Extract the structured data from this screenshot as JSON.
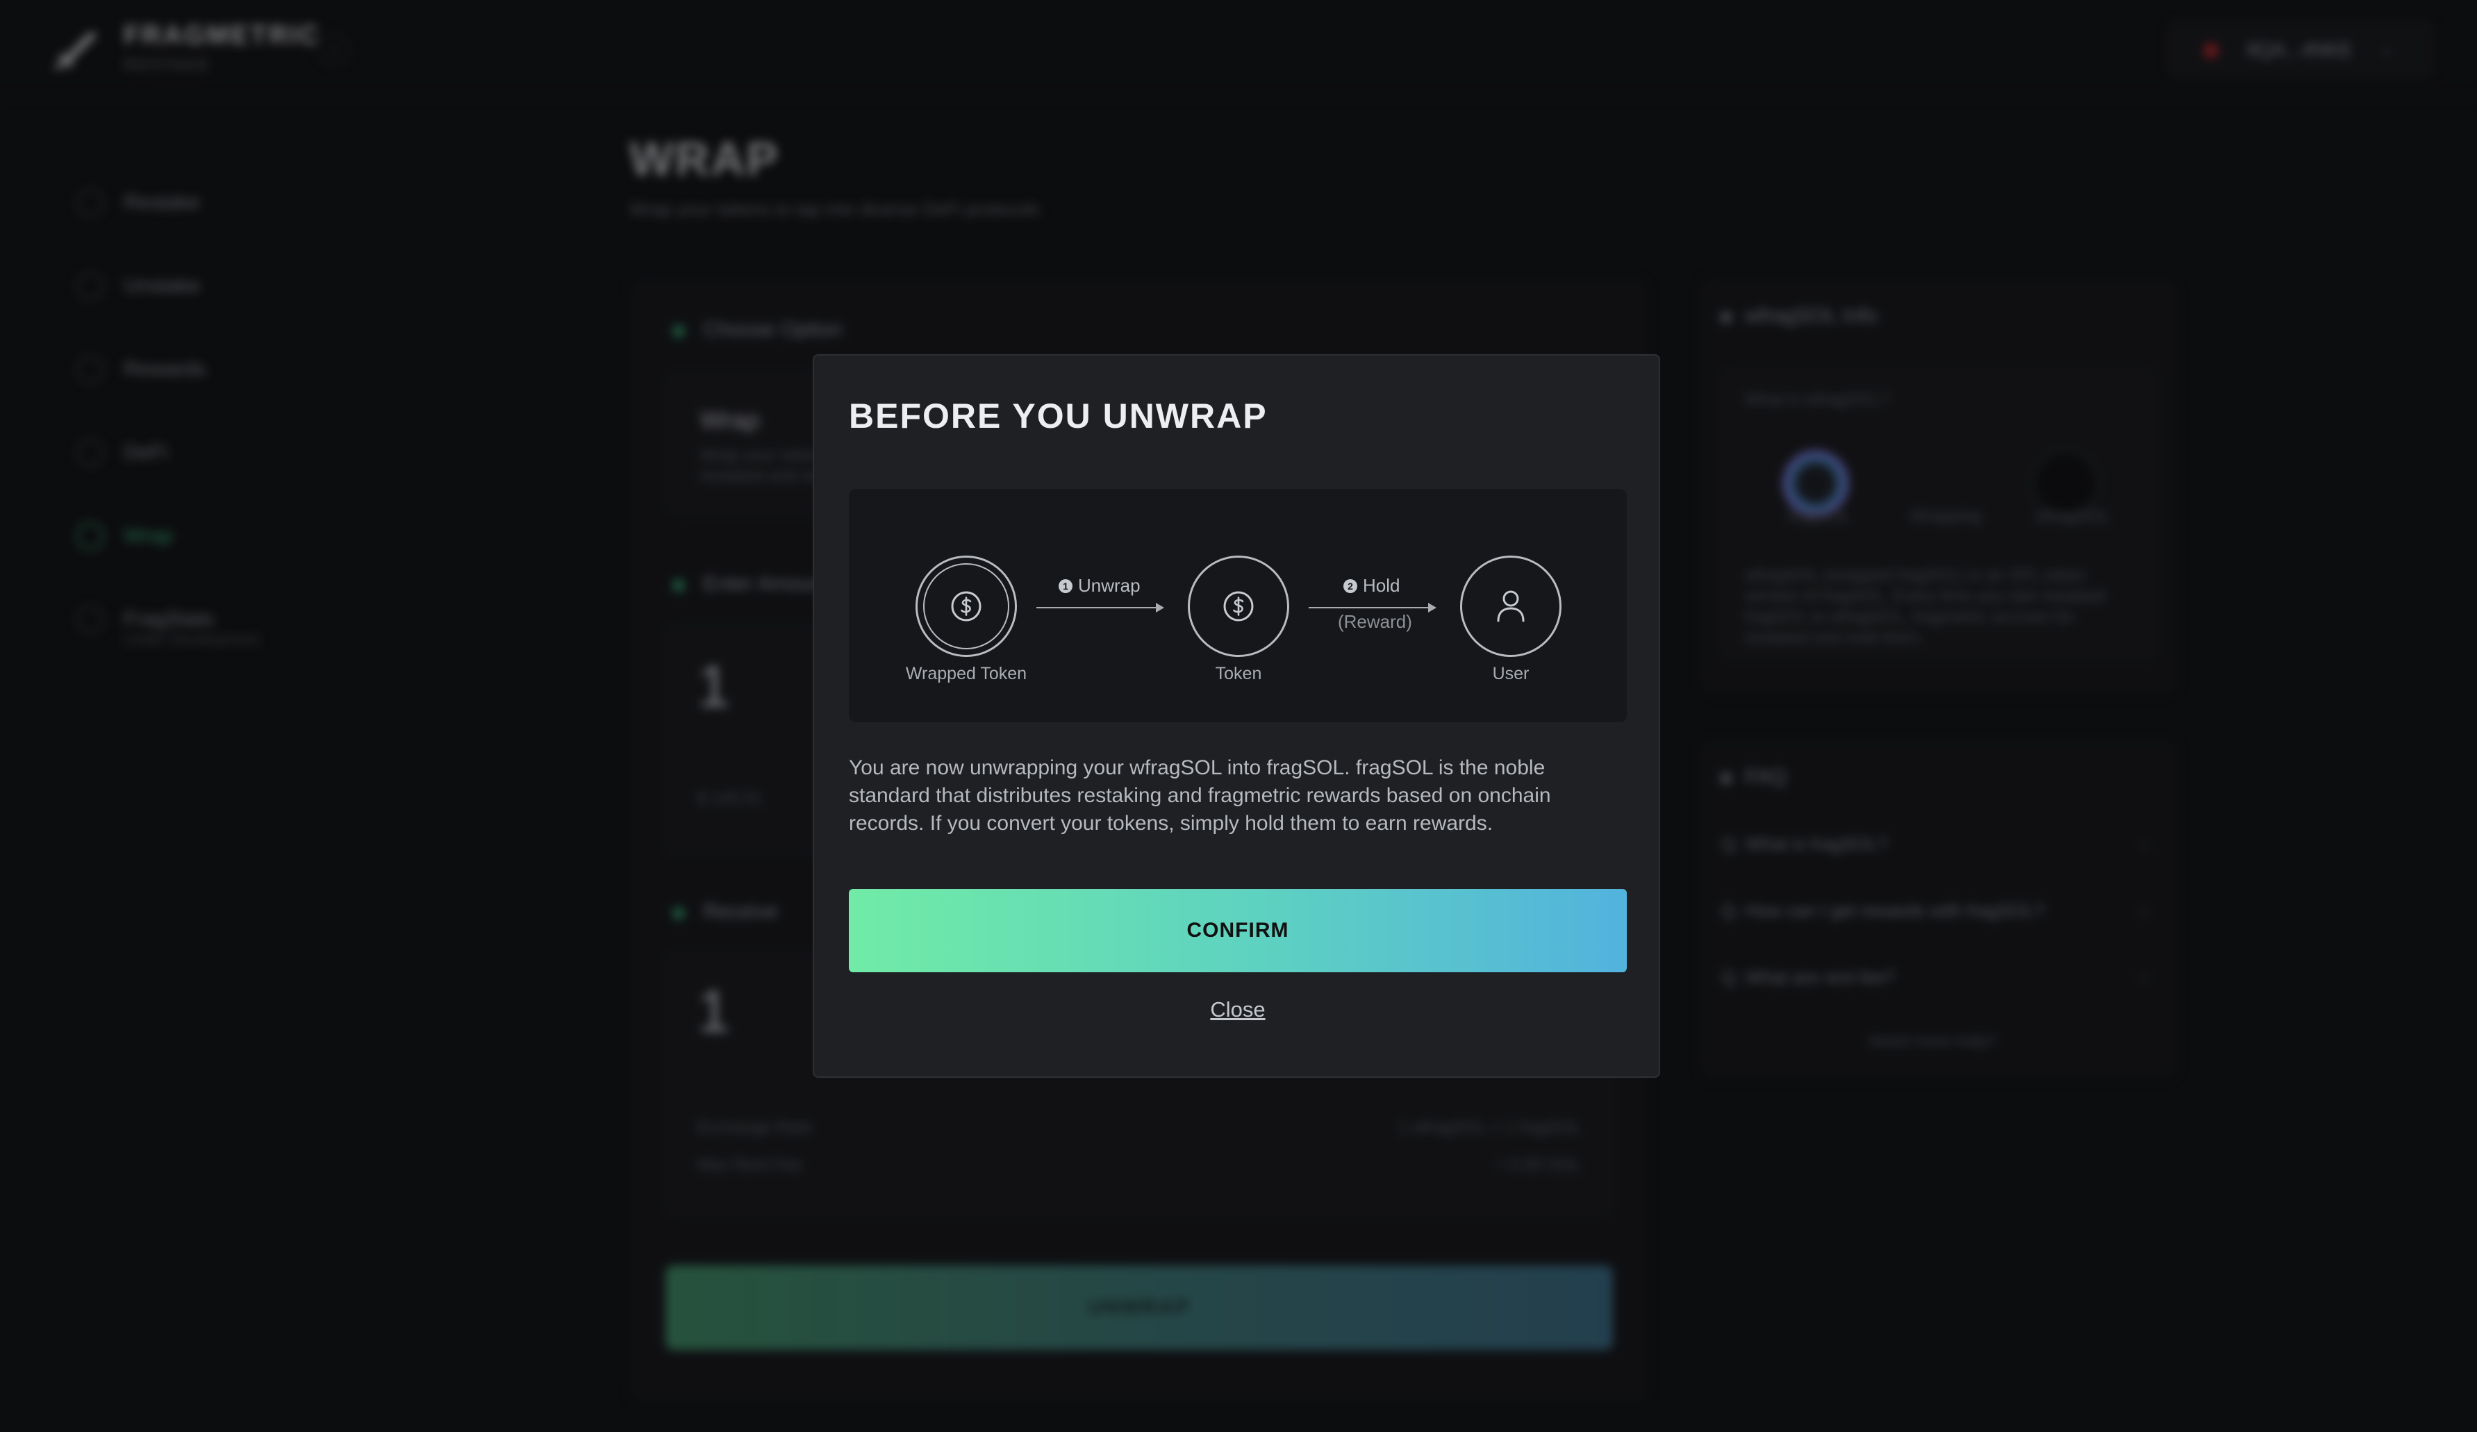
{
  "app": {
    "logo_name": "FRAGMETRIC",
    "logo_sub": "RESTAKE",
    "collapse_icon": "chevron-left",
    "wallet": {
      "address": "9QA...4NKE",
      "chevron": "⌄"
    }
  },
  "sidebar": {
    "items": [
      {
        "label": "Restake",
        "icon": "restake-icon"
      },
      {
        "label": "Unstake",
        "icon": "unstake-icon"
      },
      {
        "label": "Rewards",
        "icon": "trophy-icon"
      },
      {
        "label": "DeFi",
        "icon": "defi-icon"
      },
      {
        "label": "Wrap",
        "icon": "wrap-icon",
        "active": true
      },
      {
        "label": "FragStats",
        "icon": "stats-icon",
        "sub": "Under Development"
      }
    ]
  },
  "page": {
    "title": "WRAP",
    "subtitle": "Wrap your tokens to tap into diverse DeFi protocols"
  },
  "main": {
    "choose_option_label": "Choose Option",
    "option_title": "Wrap",
    "option_desc_1": "Wrap your tokens",
    "option_desc_2": "restaked and rewarded",
    "enter_amount_label": "Enter Amount",
    "amount_value": "1",
    "amount_usd": "$ 145.51",
    "receive_label": "Receive",
    "receive_value": "1",
    "exchange_rate_label": "Exchange Rate",
    "exchange_rate_value": "1 wfragSOL = 1 fragSOL",
    "max_rent_label": "Max Rent Fee",
    "max_rent_value": "≈ 0.00 SOL",
    "unwrap_button": "UNWRAP"
  },
  "info_panel": {
    "title": "wfragSOL Info",
    "what_is": "What is wfragSOL?",
    "token_a": "fragSOL",
    "token_mid": "Wrapping",
    "token_b": "wfragSOL",
    "desc": "wfragSOL (wrapped fragSOL) is an SPL token version of fragSOL. Every time you rate restaked fragSOL to wfragSOL, fragmetric accrues for restaked and hold them."
  },
  "faq_panel": {
    "title": "FAQ",
    "items": [
      "Q. What is fragSOL?",
      "Q. How can I get rewards with fragSOL?",
      "Q. What are rent fee?"
    ],
    "more": "Need more help?"
  },
  "modal": {
    "title": "BEFORE YOU UNWRAP",
    "diagram": {
      "node_wrapped_label": "Wrapped Token",
      "node_token_label": "Token",
      "node_user_label": "User",
      "step1_num": "1",
      "step1_label": "Unwrap",
      "step2_num": "2",
      "step2_label": "Hold",
      "step2_sub": "(Reward)"
    },
    "description": "You are now unwrapping your wfragSOL into fragSOL. fragSOL is the noble standard that distributes restaking and fragmetric rewards based on onchain records. If you convert your tokens, simply hold them to earn rewards.",
    "confirm_button": "CONFIRM",
    "close_link": "Close"
  },
  "colors": {
    "accent_green": "#71eba6",
    "accent_blue": "#52b3dd",
    "modal_bg": "#1e2024",
    "page_bg": "#101113"
  }
}
